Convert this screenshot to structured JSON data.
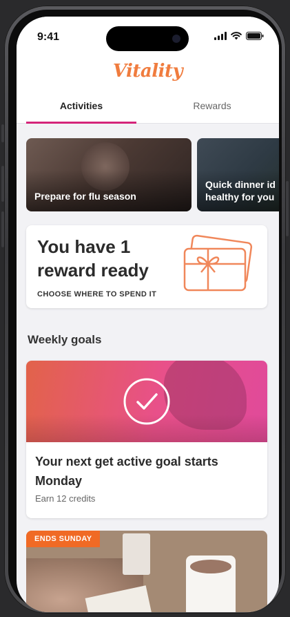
{
  "status_bar": {
    "time": "9:41"
  },
  "header": {
    "logo_text": "Vitality"
  },
  "tabs": [
    {
      "label": "Activities",
      "active": true
    },
    {
      "label": "Rewards",
      "active": false
    }
  ],
  "carousel": [
    {
      "caption": "Prepare for flu season"
    },
    {
      "caption": "Quick dinner id healthy for you"
    }
  ],
  "reward_card": {
    "title": "You have 1 reward ready",
    "cta": "CHOOSE WHERE TO SPEND IT"
  },
  "weekly_goals": {
    "section_title": "Weekly goals",
    "goal": {
      "title": "Your next get active goal starts Monday",
      "subtitle": "Earn 12 credits"
    }
  },
  "promo_card": {
    "badge": "ENDS SUNDAY"
  },
  "colors": {
    "accent_magenta": "#d4247a",
    "brand_orange": "#f07c3e",
    "badge_orange": "#f06a25"
  }
}
